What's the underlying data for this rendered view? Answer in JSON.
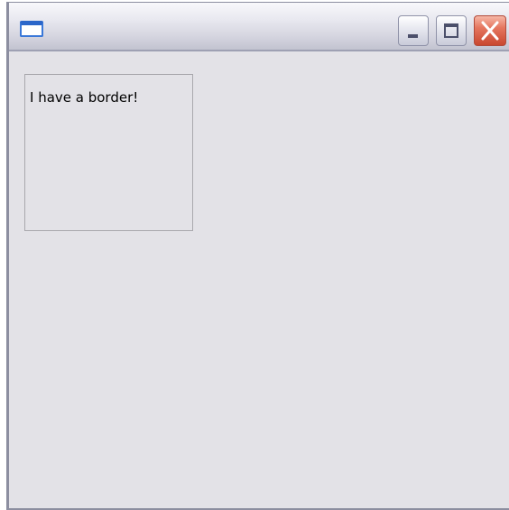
{
  "window": {
    "title": "",
    "buttons": {
      "minimize": "minimize",
      "maximize": "maximize",
      "close": "close"
    }
  },
  "content": {
    "box_text": "I have a border!"
  },
  "colors": {
    "client_background": "#e3e2e7",
    "close_button": "#d9573f",
    "border": "#a9a8ad"
  },
  "icons": [
    "window-icon",
    "minimize-icon",
    "maximize-icon",
    "close-icon"
  ]
}
